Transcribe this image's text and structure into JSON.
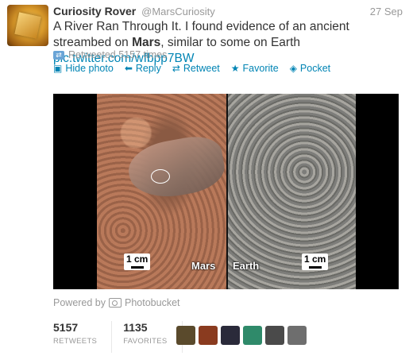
{
  "tweet": {
    "author_name": "Curiosity Rover",
    "author_handle": "@MarsCuriosity",
    "date": "27 Sep",
    "text_part1": "A River Ran Through It. I found evidence of an ancient streambed on ",
    "text_bold": "Mars",
    "text_part2": ", similar to some on Earth ",
    "link": "pic.twitter.com/wfbpp7BW"
  },
  "retweeted": "Retweeted 5157 times",
  "actions": {
    "hide_photo": "Hide photo",
    "reply": "Reply",
    "retweet": "Retweet",
    "favorite": "Favorite",
    "pocket": "Pocket"
  },
  "media": {
    "scale_left": "1 cm",
    "scale_right": "1 cm",
    "label_mars": "Mars",
    "label_earth": "Earth"
  },
  "powered_by": {
    "prefix": "Powered by",
    "service": "Photobucket"
  },
  "stats": {
    "retweets_value": "5157",
    "retweets_label": "RETWEETS",
    "favorites_value": "1135",
    "favorites_label": "FAVORITES"
  },
  "facepile_colors": [
    "#5a4a2c",
    "#8a3b1f",
    "#2a2a3a",
    "#2f8a6a",
    "#4a4a4a",
    "#6e6e6e"
  ],
  "icons": [
    "photo-icon",
    "reply-icon",
    "retweet-icon",
    "favorite-icon",
    "pocket-icon",
    "retweet-badge-icon",
    "camera-icon"
  ]
}
